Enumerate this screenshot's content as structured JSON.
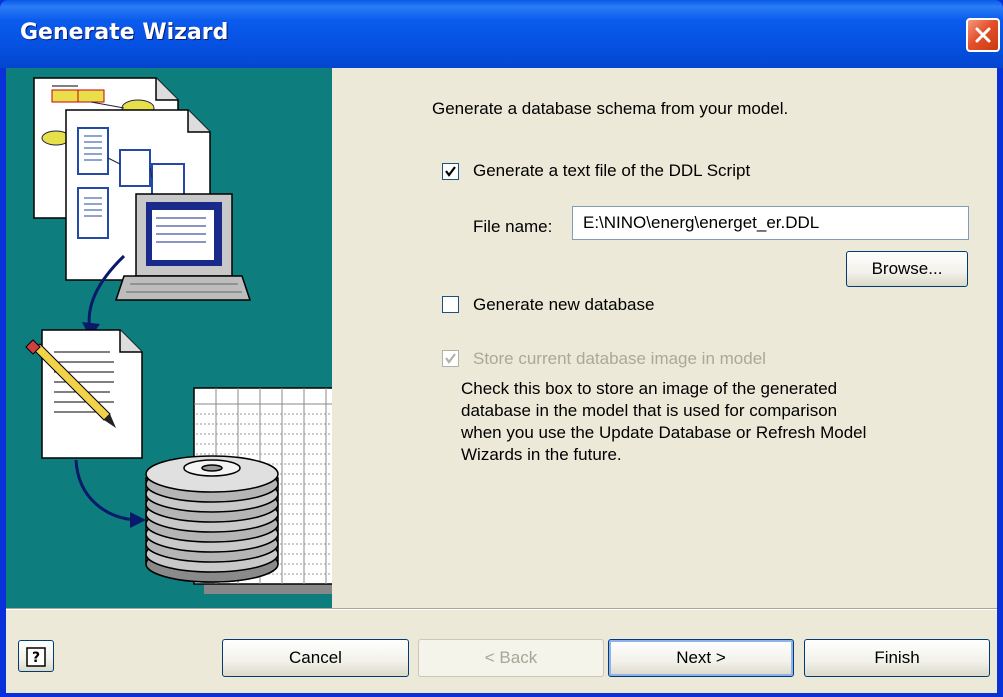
{
  "window": {
    "title": "Generate Wizard"
  },
  "main": {
    "intro": "Generate a database schema from your model.",
    "ddl_checkbox": {
      "label": "Generate a text file of the DDL Script",
      "checked": true
    },
    "file_name": {
      "label": "File name:",
      "value": "E:\\NINO\\energ\\energet_er.DDL"
    },
    "browse_label": "Browse...",
    "new_db_checkbox": {
      "label": "Generate new database",
      "checked": false
    },
    "store_checkbox": {
      "label": "Store current database image in model",
      "checked": true,
      "disabled": true
    },
    "store_description": "Check this box to store an image of the generated database in the model that is used for comparison when you use the Update Database or Refresh Model Wizards in the future."
  },
  "footer": {
    "help_icon": "help-question-icon",
    "cancel_label": "Cancel",
    "back_label": "< Back",
    "next_label": "Next >",
    "finish_label": "Finish"
  },
  "colors": {
    "titlebar": "#0550e0",
    "panel": "#0d7d7d",
    "dialog_bg": "#ece9d8",
    "close_button": "#e4502b"
  }
}
